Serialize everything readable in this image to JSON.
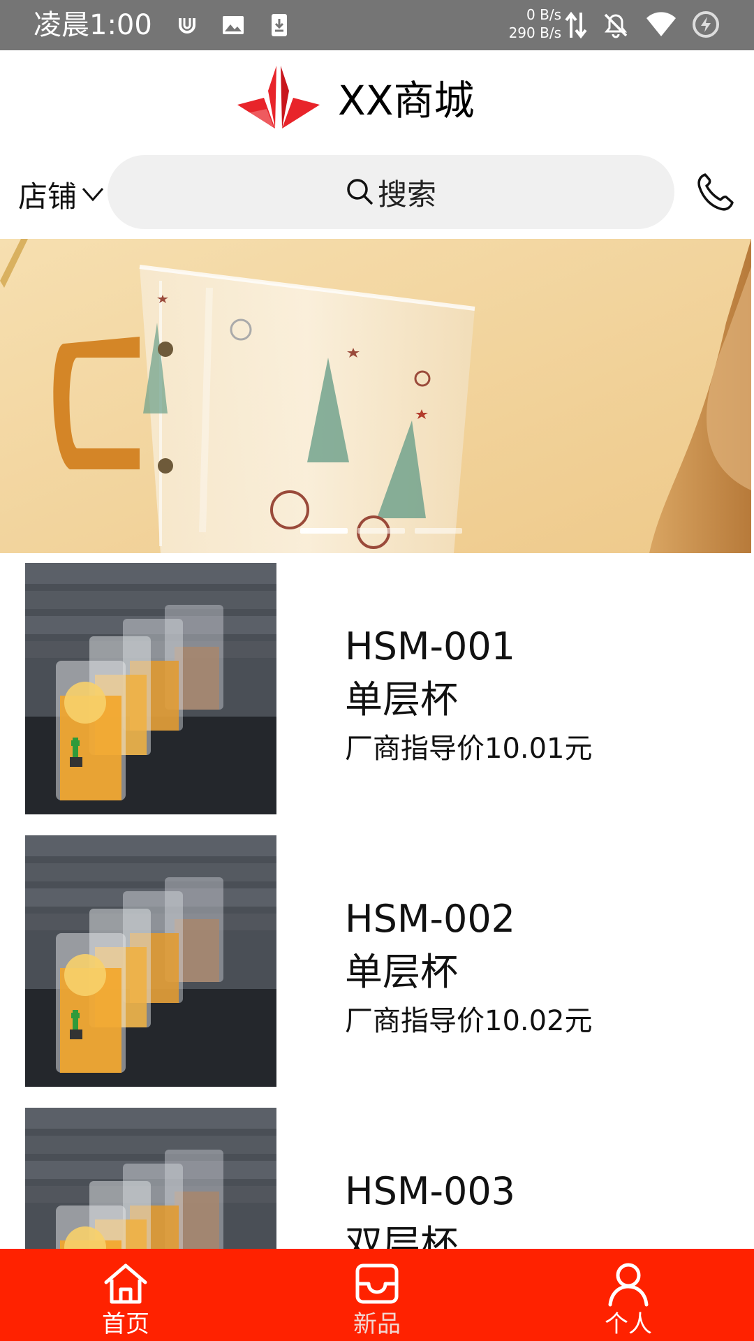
{
  "status_bar": {
    "time": "凌晨1:00",
    "net_up": "0 B/s",
    "net_down": "290 B/s",
    "icons": [
      "loop-icon",
      "image-icon",
      "download-icon",
      "data-arrows-icon",
      "bell-off-icon",
      "wifi-icon",
      "battery-saver-icon"
    ]
  },
  "header": {
    "title": "XX商城",
    "logo_color": "#e8242a"
  },
  "search": {
    "shop_label": "店铺",
    "placeholder": "搜索"
  },
  "banner": {
    "slide_count": 3,
    "active_slide": 1
  },
  "products": [
    {
      "code": "HSM-001",
      "name": "单层杯",
      "price": "厂商指导价10.01元"
    },
    {
      "code": "HSM-002",
      "name": "单层杯",
      "price": "厂商指导价10.02元"
    },
    {
      "code": "HSM-003",
      "name": "双层杯",
      "price": ""
    }
  ],
  "nav": {
    "items": [
      {
        "label": "首页",
        "icon": "home-icon"
      },
      {
        "label": "新品",
        "icon": "inbox-icon"
      },
      {
        "label": "个人",
        "icon": "person-icon"
      }
    ],
    "accent": "#ff2200"
  }
}
